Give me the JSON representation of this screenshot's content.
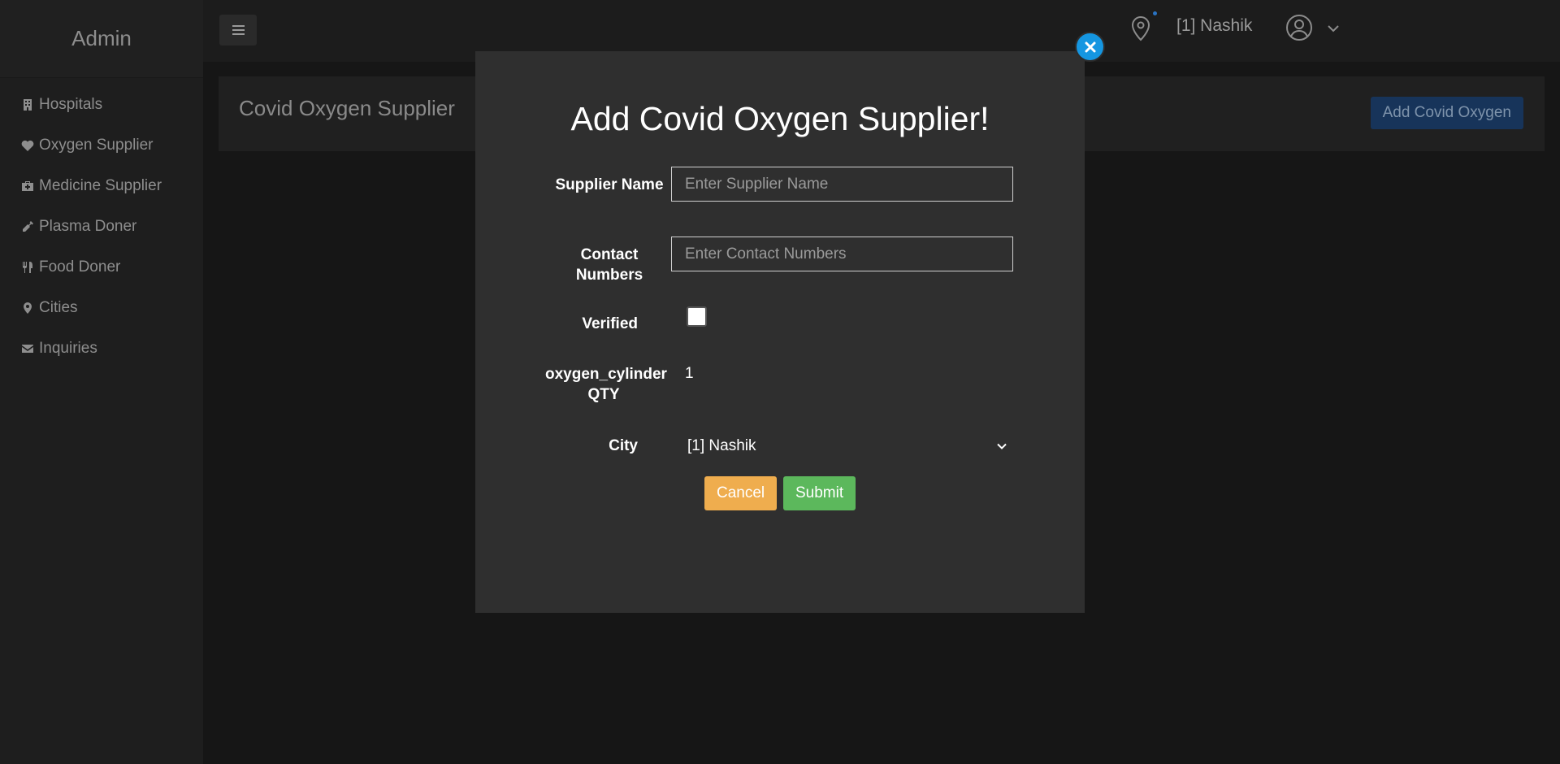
{
  "sidebar": {
    "brand": "Admin",
    "items": [
      {
        "label": "Hospitals",
        "icon": "hospital-icon"
      },
      {
        "label": "Oxygen Supplier",
        "icon": "heartbeat-icon"
      },
      {
        "label": "Medicine Supplier",
        "icon": "medkit-icon"
      },
      {
        "label": "Plasma Doner",
        "icon": "syringe-icon"
      },
      {
        "label": "Food Doner",
        "icon": "cutlery-icon"
      },
      {
        "label": "Cities",
        "icon": "map-marker-icon"
      },
      {
        "label": "Inquiries",
        "icon": "envelope-icon"
      }
    ]
  },
  "topbar": {
    "city": "[1] Nashik",
    "icons": [
      "menu-icon",
      "location-icon",
      "user-icon",
      "chevron-down-icon"
    ]
  },
  "page": {
    "title": "Covid Oxygen Supplier",
    "add_button": "Add Covid Oxygen"
  },
  "modal": {
    "title": "Add Covid Oxygen Supplier!",
    "fields": {
      "supplier_name_label": "Supplier Name",
      "supplier_name_placeholder": "Enter Supplier Name",
      "contact_label": "Contact Numbers",
      "contact_placeholder": "Enter Contact Numbers",
      "verified_label": "Verified",
      "qty_label": "oxygen_cylinder QTY",
      "qty_value": "1",
      "city_label": "City",
      "city_value": "[1] Nashik"
    },
    "cancel_label": "Cancel",
    "submit_label": "Submit",
    "colors": {
      "close": "#1596e1",
      "cancel": "#efad4e",
      "submit": "#5cb85c"
    }
  }
}
